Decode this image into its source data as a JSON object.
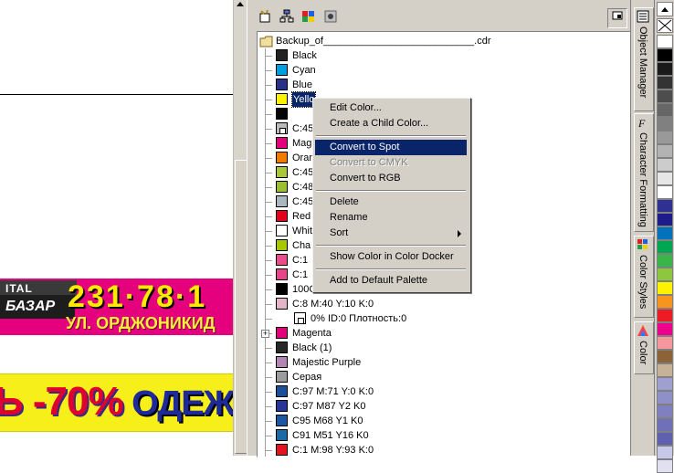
{
  "canvas": {
    "banner1": {
      "logo_top": "ITAL",
      "logo_mid": "БАЗАР",
      "phone": "231·78·1",
      "address": "УЛ. ОРДЖОНИКИД"
    },
    "banner2": {
      "text_red": "Ь -70%",
      "text_blue": " ОДЕЖ"
    }
  },
  "docker": {
    "toolbar": [
      {
        "icon": "new-color-icon"
      },
      {
        "icon": "tree-view-icon"
      },
      {
        "icon": "palette-view-icon"
      },
      {
        "icon": "options-icon"
      }
    ],
    "root_label": "Backup_of___________________________.cdr",
    "items": [
      {
        "label": "Black",
        "color": "#222222"
      },
      {
        "label": "Cyan",
        "color": "#00a0e0"
      },
      {
        "label": "Blue",
        "color": "#2a3085"
      },
      {
        "label": "Yello",
        "color": "#fff200",
        "selected": true
      },
      {
        "label": "",
        "color": "#050505"
      },
      {
        "label": "C:45",
        "color": "#b8bcbe",
        "special": true
      },
      {
        "label": "Mag",
        "color": "#e4007c"
      },
      {
        "label": "Oran",
        "color": "#f27a00"
      },
      {
        "label": "C:45",
        "color": "#a8c83a"
      },
      {
        "label": "C:48",
        "color": "#9ac030"
      },
      {
        "label": "C:45",
        "color": "#a9b7c0"
      },
      {
        "label": "Red",
        "color": "#e2001a"
      },
      {
        "label": "Whit",
        "color": "#ffffff"
      },
      {
        "label": "Cha",
        "color": "#a8c800"
      },
      {
        "label": "C:1",
        "color": "#ea4c8c"
      },
      {
        "label": "C:1",
        "color": "#e8448a"
      },
      {
        "label": "100C:100 Y:100 K:100",
        "color": "#000000"
      },
      {
        "label": "C:8 M:40 Y:10 K:0",
        "color": "#e6b4c8"
      },
      {
        "label": "0% ID:0 Плотность:0",
        "color": "#ffffff",
        "special": true,
        "indent": true
      },
      {
        "label": "Magenta",
        "color": "#e4007c",
        "expander": true
      },
      {
        "label": "Black (1)",
        "color": "#262626"
      },
      {
        "label": "Majestic Purple",
        "color": "#b484b4"
      },
      {
        "label": "Серая",
        "color": "#9c9c9c"
      },
      {
        "label": "C:97 M:71 Y:0 K:0",
        "color": "#1b4f9a"
      },
      {
        "label": "C:97 M87 Y2 K0",
        "color": "#27359a"
      },
      {
        "label": "C95 M68 Y1 K0",
        "color": "#1d56a2"
      },
      {
        "label": "C91 M51 Y16 K0",
        "color": "#1a6aa6"
      },
      {
        "label": "C:1 M:98 Y:93 K:0",
        "color": "#e4141e"
      }
    ]
  },
  "context_menu": {
    "items": [
      {
        "label": "Edit Color...",
        "state": "normal"
      },
      {
        "label": "Create a Child Color...",
        "state": "normal"
      },
      {
        "label": "Convert to Spot",
        "state": "highlighted"
      },
      {
        "label": "Convert to CMYK",
        "state": "disabled"
      },
      {
        "label": "Convert to RGB",
        "state": "normal"
      },
      {
        "label": "Delete",
        "state": "normal"
      },
      {
        "label": "Rename",
        "state": "normal"
      },
      {
        "label": "Sort",
        "state": "normal",
        "submenu": true
      },
      {
        "label": "Show Color in Color Docker",
        "state": "normal"
      },
      {
        "label": "Add to Default Palette",
        "state": "normal"
      }
    ]
  },
  "docker_tabs": [
    {
      "label": "Object Manager",
      "icon": "object-manager-icon"
    },
    {
      "label": "Character Formatting",
      "icon": "character-formatting-icon"
    },
    {
      "label": "Color Styles",
      "icon": "color-styles-icon"
    },
    {
      "label": "Color",
      "icon": "color-icon"
    }
  ],
  "palette": {
    "colors": [
      "#ffffff",
      "#000000",
      "#1a1a1a",
      "#333333",
      "#4d4d4d",
      "#666666",
      "#808080",
      "#999999",
      "#b3b3b3",
      "#cccccc",
      "#e6e6e6",
      "#ffffff",
      "#2e3092",
      "#1e1b8b",
      "#0072bc",
      "#00a651",
      "#39b54a",
      "#8dc63f",
      "#fff200",
      "#f7941d",
      "#ed1c24",
      "#ec008c",
      "#f5989d",
      "#8c6239",
      "#c7b299",
      "#a0a0d0",
      "#9090c8",
      "#8080c0",
      "#7070b8",
      "#6060b0",
      "#c8c8e8",
      "#e0e0f0"
    ]
  }
}
